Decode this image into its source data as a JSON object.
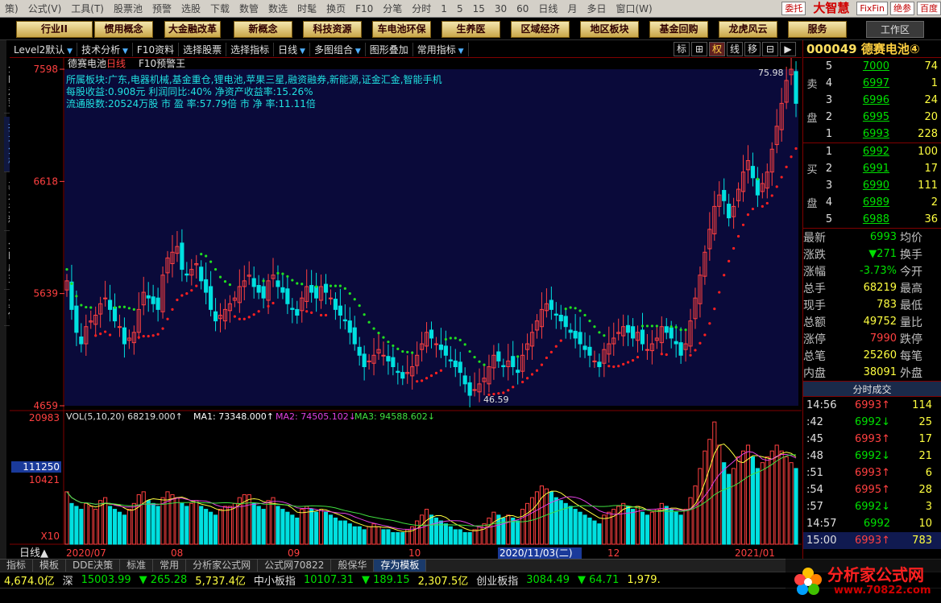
{
  "menu": [
    "策)",
    "公式(V)",
    "工具(T)",
    "股票池",
    "预警",
    "选股",
    "下载",
    "数管",
    "数选",
    "时髦",
    "换页",
    "F10",
    "分笔",
    "分时",
    "1",
    "5",
    "15",
    "30",
    "60",
    "日线",
    "月",
    "多日",
    "窗口(W)"
  ],
  "menu_right": {
    "b1": "委托",
    "brand": "大智慧",
    "b2": "FixFin",
    "b3": "绝参",
    "b4": "百度"
  },
  "toolbar": [
    "行业II",
    "惯用概念",
    "大金融改革",
    "新概念",
    "科技资源",
    "车电池环保",
    "生养医",
    "区域经济",
    "地区板块",
    "基金回购",
    "龙虎风云",
    "服务"
  ],
  "work_area": "工作区",
  "vtabs": [
    "分时走势",
    "技术分析",
    "基本资料",
    "分时成交",
    "其他"
  ],
  "chart_toolbar": [
    {
      "label": "Level2默认",
      "arrow": true
    },
    {
      "label": "技术分析",
      "arrow": true
    },
    {
      "label": "F10资料",
      "arrow": false
    },
    {
      "label": "选择股票",
      "arrow": false
    },
    {
      "label": "选择指标",
      "arrow": false
    },
    {
      "label": "日线",
      "arrow": true
    },
    {
      "label": "多图组合",
      "arrow": true
    },
    {
      "label": "图形叠加",
      "arrow": false
    },
    {
      "label": "常用指标",
      "arrow": true
    }
  ],
  "mode_icons": [
    "标",
    "⊞",
    "权",
    "线",
    "移",
    "⊟",
    "▶"
  ],
  "chart_header": {
    "name": "德赛电池",
    "period": "日线",
    "f10": "F10预警王"
  },
  "info_lines": [
    "所属板块:广东,电器机械,基金重仓,锂电池,苹果三星,融资融券,新能源,证金汇金,智能手机",
    "每股收益:0.908元   利润同比:40%   净资产收益率:15.26%",
    "流通股数:20524万股  市 盈 率:57.79倍  市 净 率:11.11倍"
  ],
  "vol_legend": {
    "vol": "VOL(5,10,20)",
    "v1": "68219.000",
    "ma1": "MA1: 73348.000",
    "ma2": "MA2: 74505.102",
    "ma3": "MA3: 94588.602"
  },
  "chart_data": {
    "type": "candlestick",
    "price_axis": {
      "ylim": [
        4659,
        7598
      ],
      "ticks": [
        "7598",
        "6618",
        "5639",
        "4659"
      ]
    },
    "volume_axis": {
      "ticks": [
        "20983",
        "111250",
        "10421",
        "X10"
      ]
    },
    "x_labels": [
      "2020/07",
      "08",
      "09",
      "10",
      "2020/11/03(二)",
      "12",
      "2021/01"
    ],
    "annotations": {
      "high": "75.98",
      "low": "46.59"
    },
    "closes": [
      5750,
      5500,
      5300,
      5200,
      5350,
      5400,
      5450,
      5550,
      5600,
      5500,
      5400,
      5350,
      5200,
      5250,
      5300,
      5500,
      5650,
      5600,
      5550,
      5500,
      5800,
      5950,
      6000,
      6050,
      5850,
      5800,
      5850,
      5900,
      5750,
      5650,
      5500,
      5400,
      5450,
      5500,
      5550,
      5600,
      5700,
      5750,
      5800,
      5700,
      5650,
      5600,
      5750,
      5800,
      5700,
      5650,
      5550,
      5500,
      5450,
      5600,
      5700,
      5650,
      5600,
      5700,
      5650,
      5600,
      5500,
      5450,
      5400,
      5300,
      5200,
      5100,
      5000,
      5050,
      5100,
      5150,
      5100,
      5050,
      5000,
      4950,
      4900,
      4950,
      5000,
      5100,
      5200,
      5300,
      5250,
      5200,
      5150,
      5100,
      5050,
      5000,
      4950,
      4850,
      4750,
      4800,
      4850,
      4900,
      5000,
      5100,
      5050,
      5000,
      5050,
      5000,
      4950,
      5100,
      5200,
      5300,
      5400,
      5500,
      5550,
      5500,
      5450,
      5400,
      5350,
      5300,
      5250,
      5200,
      5150,
      5100,
      5050,
      5000,
      5150,
      5200,
      5250,
      5300,
      5350,
      5300,
      5250,
      5300,
      5200,
      5150,
      5200,
      5250,
      5350,
      5300,
      5250,
      5200,
      5100,
      5200,
      5400,
      5600,
      5800,
      6000,
      6200,
      6400,
      6500,
      6450,
      6300,
      6400,
      6550,
      6700,
      6800,
      6650,
      6500,
      6600,
      6700,
      6900,
      7100,
      7300,
      7500,
      7598,
      7300
    ],
    "vol": [
      9000,
      7000,
      6500,
      6000,
      7000,
      6500,
      6000,
      7500,
      8000,
      6500,
      6000,
      5500,
      5000,
      6000,
      7000,
      8500,
      9000,
      7500,
      7000,
      6500,
      8000,
      9000,
      8500,
      8000,
      7000,
      6500,
      7000,
      7500,
      6500,
      6000,
      5500,
      5000,
      6000,
      6500,
      6500,
      7000,
      8000,
      8500,
      8500,
      7000,
      6500,
      6000,
      7500,
      8000,
      6500,
      6000,
      5500,
      5000,
      4500,
      6000,
      6500,
      6000,
      5500,
      6000,
      5500,
      5000,
      4500,
      4000,
      4000,
      3500,
      3000,
      3000,
      2500,
      3000,
      3500,
      3000,
      2500,
      2500,
      2000,
      2000,
      2000,
      2500,
      3000,
      4000,
      5000,
      6000,
      5000,
      4500,
      4000,
      3500,
      3000,
      2500,
      2500,
      2000,
      2000,
      2500,
      3000,
      3500,
      4500,
      5500,
      5000,
      4500,
      5000,
      4500,
      4000,
      6000,
      7000,
      8000,
      9000,
      10000,
      9500,
      9000,
      8000,
      7500,
      7000,
      6500,
      6000,
      5500,
      5000,
      4500,
      4000,
      3500,
      5000,
      5500,
      6000,
      6500,
      7000,
      6500,
      6000,
      6500,
      5500,
      5000,
      5500,
      6000,
      7000,
      6500,
      6000,
      5500,
      5000,
      6000,
      8000,
      10000,
      13000,
      16000,
      18000,
      20983,
      17000,
      14000,
      12000,
      13000,
      15000,
      16000,
      17000,
      15000,
      13000,
      14000,
      15000,
      16000,
      17000,
      16000,
      15000,
      14000,
      13000
    ]
  },
  "stock_header": {
    "code": "000049",
    "name": "德赛电池④"
  },
  "asks": [
    {
      "idx": "5",
      "price": "7000",
      "vol": "74"
    },
    {
      "idx": "4",
      "price": "6997",
      "vol": "1"
    },
    {
      "idx": "3",
      "price": "6996",
      "vol": "24"
    },
    {
      "idx": "2",
      "price": "6995",
      "vol": "20"
    },
    {
      "idx": "1",
      "price": "6993",
      "vol": "228"
    }
  ],
  "bids": [
    {
      "idx": "1",
      "price": "6992",
      "vol": "100"
    },
    {
      "idx": "2",
      "price": "6991",
      "vol": "17"
    },
    {
      "idx": "3",
      "price": "6990",
      "vol": "111"
    },
    {
      "idx": "4",
      "price": "6989",
      "vol": "2"
    },
    {
      "idx": "5",
      "price": "6988",
      "vol": "36"
    }
  ],
  "ask_label": "卖 盘",
  "bid_label": "买 盘",
  "quote": [
    {
      "l": "最新",
      "v": "6993",
      "r": "均价",
      "c": "g"
    },
    {
      "l": "涨跌",
      "v": "▼271",
      "r": "换手",
      "c": "g"
    },
    {
      "l": "涨幅",
      "v": "-3.73%",
      "r": "今开",
      "c": "g"
    },
    {
      "l": "总手",
      "v": "68219",
      "r": "最高",
      "c": "w"
    },
    {
      "l": "现手",
      "v": "783",
      "r": "最低",
      "c": "w"
    },
    {
      "l": "总额",
      "v": "49752",
      "r": "量比",
      "c": "w"
    },
    {
      "l": "涨停",
      "v": "7990",
      "r": "跌停",
      "c": "r"
    },
    {
      "l": "总笔",
      "v": "25260",
      "r": "每笔",
      "c": "w"
    },
    {
      "l": "内盘",
      "v": "38091",
      "r": "外盘",
      "c": "w"
    }
  ],
  "tick_header": "分时成交",
  "ticks": [
    {
      "t": "14:56",
      "p": "6993↑",
      "v": "114",
      "up": true
    },
    {
      "t": ":42",
      "p": "6992↓",
      "v": "25",
      "up": false
    },
    {
      "t": ":45",
      "p": "6993↑",
      "v": "17",
      "up": true
    },
    {
      "t": ":48",
      "p": "6992↓",
      "v": "21",
      "up": false
    },
    {
      "t": ":51",
      "p": "6993↑",
      "v": "6",
      "up": true
    },
    {
      "t": ":54",
      "p": "6995↑",
      "v": "28",
      "up": true
    },
    {
      "t": ":57",
      "p": "6992↓",
      "v": "3",
      "up": false
    },
    {
      "t": "14:57",
      "p": "6992",
      "v": "10",
      "up": false
    },
    {
      "t": "15:00",
      "p": "6993↑",
      "v": "783",
      "up": true
    }
  ],
  "bottom_tabs": [
    "指标",
    "模板",
    "DDE决策",
    "标准",
    "常用",
    "分析家公式网",
    "公式网70822",
    "般保华",
    "存为模板"
  ],
  "ticker": [
    {
      "t": "4,674.0亿",
      "c": "y"
    },
    {
      "t": "深",
      "c": "w"
    },
    {
      "t": "15003.99",
      "c": "g"
    },
    {
      "t": "▼ 265.28",
      "c": "g"
    },
    {
      "t": "5,737.4亿",
      "c": "y"
    },
    {
      "t": "中小板指",
      "c": "w"
    },
    {
      "t": "10107.31",
      "c": "g"
    },
    {
      "t": "▼ 189.15",
      "c": "g"
    },
    {
      "t": "2,307.5亿",
      "c": "y"
    },
    {
      "t": "创业板指",
      "c": "w"
    },
    {
      "t": "3084.49",
      "c": "g"
    },
    {
      "t": "▼ 64.71",
      "c": "g"
    },
    {
      "t": "1,979.",
      "c": "y"
    }
  ],
  "watermark": {
    "title": "分析家公式网",
    "url": "www.70822.com"
  },
  "day_label": "日线▲",
  "colors": {
    "up": "#ff4040",
    "down": "#00e0e0",
    "border": "#800000",
    "sar_red": "#ff2020",
    "sar_green": "#20e020",
    "ma1": "#ffffff",
    "ma2": "#e040e0",
    "ma3": "#40e040"
  }
}
